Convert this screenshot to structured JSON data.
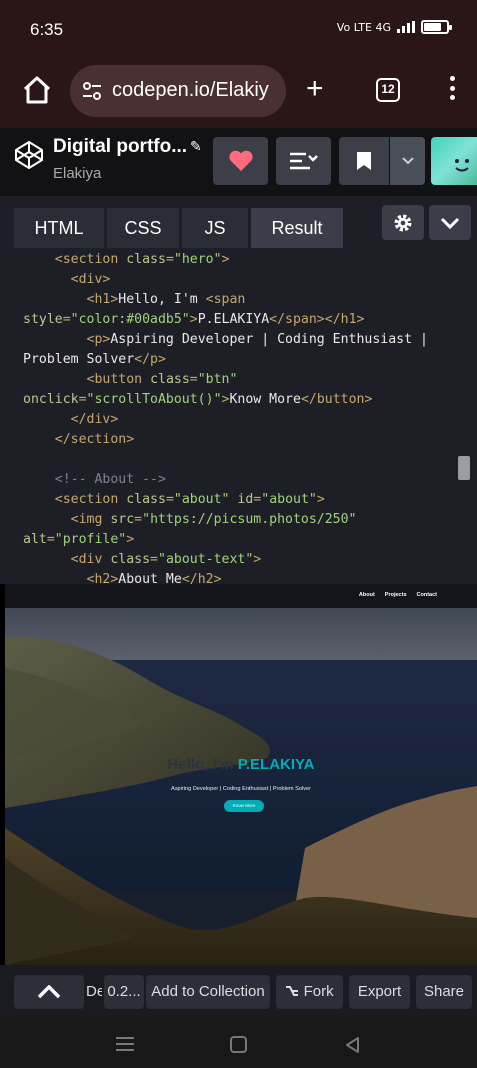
{
  "status_bar": {
    "time": "6:35",
    "signal_text": "Vo LTE 4G",
    "battery_level": 0.75
  },
  "browser": {
    "url": "codepen.io/Elakiy",
    "tab_count": "12"
  },
  "pen": {
    "title": "Digital portfo...",
    "author": "Elakiya"
  },
  "editor": {
    "tabs": [
      {
        "label": "HTML"
      },
      {
        "label": "CSS"
      },
      {
        "label": "JS"
      },
      {
        "label": "Result"
      }
    ],
    "code_lines": [
      [
        {
          "t": "    "
        },
        {
          "t": "<section ",
          "c": "t"
        },
        {
          "t": "class",
          "c": "a"
        },
        {
          "t": "=",
          "c": "t"
        },
        {
          "t": "\"hero\"",
          "c": "s"
        },
        {
          "t": ">",
          "c": "t"
        }
      ],
      [
        {
          "t": "      "
        },
        {
          "t": "<div>",
          "c": "t"
        }
      ],
      [
        {
          "t": "        "
        },
        {
          "t": "<h1>",
          "c": "t"
        },
        {
          "t": "Hello, I'm "
        },
        {
          "t": "<span ",
          "c": "t"
        }
      ],
      [
        {
          "t": "style",
          "c": "a"
        },
        {
          "t": "=",
          "c": "t"
        },
        {
          "t": "\"color:#00adb5\"",
          "c": "s"
        },
        {
          "t": ">",
          "c": "t"
        },
        {
          "t": "P.ELAKIYA"
        },
        {
          "t": "</span>",
          "c": "t"
        },
        {
          "t": "</h1>",
          "c": "t"
        }
      ],
      [
        {
          "t": "        "
        },
        {
          "t": "<p>",
          "c": "t"
        },
        {
          "t": "Aspiring Developer | Coding Enthusiast |"
        }
      ],
      [
        {
          "t": "Problem Solver"
        },
        {
          "t": "</p>",
          "c": "t"
        }
      ],
      [
        {
          "t": "        "
        },
        {
          "t": "<button ",
          "c": "t"
        },
        {
          "t": "class",
          "c": "a"
        },
        {
          "t": "=",
          "c": "t"
        },
        {
          "t": "\"btn\"",
          "c": "s"
        }
      ],
      [
        {
          "t": "onclick",
          "c": "a"
        },
        {
          "t": "=",
          "c": "t"
        },
        {
          "t": "\"scrollToAbout()\"",
          "c": "s"
        },
        {
          "t": ">",
          "c": "t"
        },
        {
          "t": "Know More"
        },
        {
          "t": "</button>",
          "c": "t"
        }
      ],
      [
        {
          "t": "      "
        },
        {
          "t": "</div>",
          "c": "t"
        }
      ],
      [
        {
          "t": "    "
        },
        {
          "t": "</section>",
          "c": "t"
        }
      ],
      [
        {
          "t": ""
        }
      ],
      [
        {
          "t": "    "
        },
        {
          "t": "<!-- About -->",
          "c": "c"
        }
      ],
      [
        {
          "t": "    "
        },
        {
          "t": "<section ",
          "c": "t"
        },
        {
          "t": "class",
          "c": "a"
        },
        {
          "t": "=",
          "c": "t"
        },
        {
          "t": "\"about\"",
          "c": "s"
        },
        {
          "t": " id",
          "c": "a"
        },
        {
          "t": "=",
          "c": "t"
        },
        {
          "t": "\"about\"",
          "c": "s"
        },
        {
          "t": ">",
          "c": "t"
        }
      ],
      [
        {
          "t": "      "
        },
        {
          "t": "<img ",
          "c": "t"
        },
        {
          "t": "src",
          "c": "a"
        },
        {
          "t": "=",
          "c": "t"
        },
        {
          "t": "\"https://picsum.photos/250\"",
          "c": "s"
        }
      ],
      [
        {
          "t": "alt",
          "c": "a"
        },
        {
          "t": "=",
          "c": "t"
        },
        {
          "t": "\"profile\"",
          "c": "s"
        },
        {
          "t": ">",
          "c": "t"
        }
      ],
      [
        {
          "t": "      "
        },
        {
          "t": "<div ",
          "c": "t"
        },
        {
          "t": "class",
          "c": "a"
        },
        {
          "t": "=",
          "c": "t"
        },
        {
          "t": "\"about-text\"",
          "c": "s"
        },
        {
          "t": ">",
          "c": "t"
        }
      ],
      [
        {
          "t": "        "
        },
        {
          "t": "<h2>",
          "c": "t"
        },
        {
          "t": "About Me"
        },
        {
          "t": "</h2>",
          "c": "t"
        }
      ]
    ]
  },
  "preview": {
    "nav_links": [
      "About",
      "Projects",
      "Contact"
    ],
    "hello_text": "Hello, I'm",
    "name": "P.ELAKIYA",
    "subtitle": "Aspiring Developer | Coding Enthusiast | Problem Solver",
    "button_label": "Know More"
  },
  "bottom_bar": {
    "truncated_label": "De",
    "version": "0.2...",
    "collection_label": "Add to Collection",
    "fork_label": "Fork",
    "export_label": "Export",
    "share_label": "Share"
  },
  "colors": {
    "accent": "#00adb5",
    "editor_bg": "#1e1f26",
    "heart": "#ff6b7a"
  }
}
